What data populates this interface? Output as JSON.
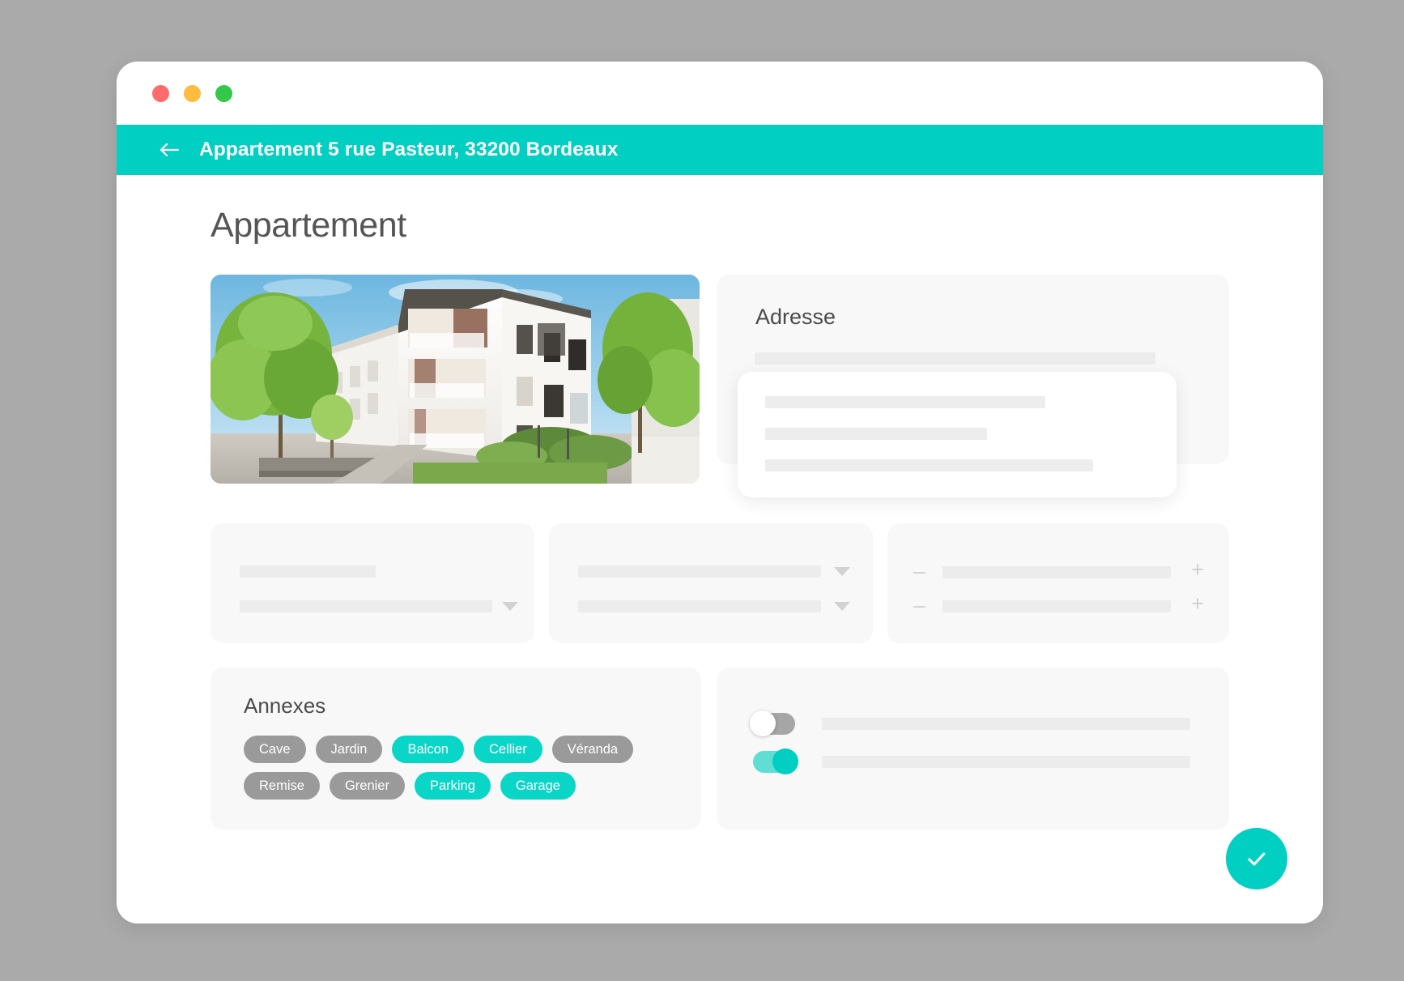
{
  "window": {
    "traffic_lights": [
      {
        "name": "close",
        "color": "#ff6b6b"
      },
      {
        "name": "minimize",
        "color": "#fdbc40"
      },
      {
        "name": "maximize",
        "color": "#34c84a"
      }
    ]
  },
  "appbar": {
    "back_icon": "arrow-left-icon",
    "title": "Appartement 5 rue Pasteur, 33200 Bordeaux",
    "background": "#00cfc1"
  },
  "page": {
    "title": "Appartement"
  },
  "photo": {
    "alt": "Modern white apartment building with balconies and trees"
  },
  "adresse": {
    "title": "Adresse",
    "suggestions_panel": {
      "rows": 3
    }
  },
  "form_cards": {
    "card_a": {
      "dropdown_icon": "chevron-down-icon"
    },
    "card_b": {
      "dropdown_icon": "chevron-down-icon"
    },
    "card_c": {
      "minus_label": "–",
      "plus_label": "+",
      "rows": 2
    }
  },
  "annexes": {
    "title": "Annexes",
    "chips": [
      {
        "label": "Cave",
        "selected": false
      },
      {
        "label": "Jardin",
        "selected": false
      },
      {
        "label": "Balcon",
        "selected": true
      },
      {
        "label": "Cellier",
        "selected": true
      },
      {
        "label": "Véranda",
        "selected": false
      },
      {
        "label": "Remise",
        "selected": false
      },
      {
        "label": "Grenier",
        "selected": false
      },
      {
        "label": "Parking",
        "selected": true
      },
      {
        "label": "Garage",
        "selected": true
      }
    ]
  },
  "toggles": [
    {
      "name": "toggle-one",
      "on": false
    },
    {
      "name": "toggle-two",
      "on": true
    }
  ],
  "fab": {
    "icon": "check-icon",
    "color": "#00cfc1"
  },
  "colors": {
    "accent": "#00cfc1",
    "chip_on": "#0ad6c8",
    "chip_off": "#9a9a9a",
    "card_bg": "#f8f8f8",
    "skeleton": "#ececec",
    "desk_bg": "#aaaaaa"
  }
}
